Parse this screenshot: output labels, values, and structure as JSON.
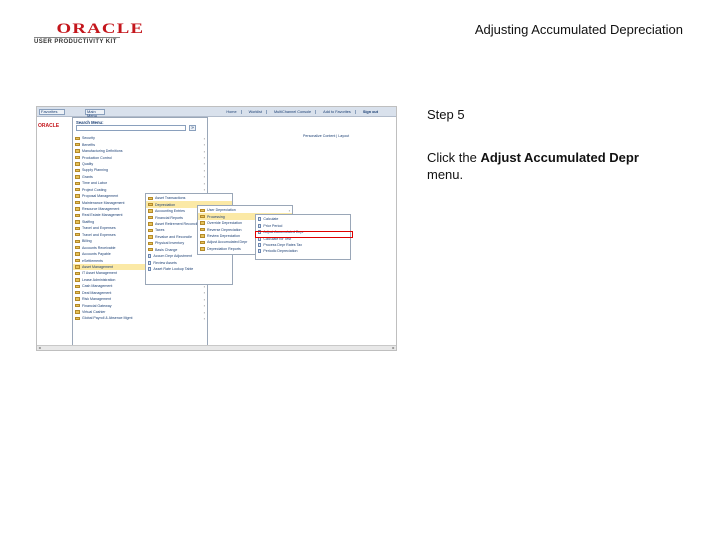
{
  "header": {
    "logo_text": "ORACLE",
    "logo_subtext": "USER PRODUCTIVITY KIT",
    "title": "Adjusting Accumulated Depreciation"
  },
  "instruction": {
    "step_label": "Step 5",
    "text_before": "Click the ",
    "target": "Adjust Accumulated Depr",
    "text_after": " menu."
  },
  "screenshot": {
    "topbar": {
      "favorites": "Favorites",
      "main_menu": "Main Menu",
      "links": [
        "Home",
        "Worklist",
        "MultiChannel Console",
        "Add to Favorites",
        "Sign out"
      ]
    },
    "app_logo": "ORACLE",
    "personalize": "Personalize Content | Layout",
    "search_title": "Search Menu:",
    "search_go": "»",
    "main_menu_items": [
      {
        "label": "Security",
        "icon": "folder-icon",
        "chevron": true
      },
      {
        "label": "Benefits",
        "icon": "folder-icon",
        "chevron": true
      },
      {
        "label": "Manufacturing Definitions",
        "icon": "folder-icon",
        "chevron": true
      },
      {
        "label": "Production Control",
        "icon": "folder-icon",
        "chevron": true
      },
      {
        "label": "Quality",
        "icon": "folder-icon",
        "chevron": true
      },
      {
        "label": "Supply Planning",
        "icon": "folder-icon",
        "chevron": true
      },
      {
        "label": "Grants",
        "icon": "folder-icon",
        "chevron": true
      },
      {
        "label": "Time and Labor",
        "icon": "folder-icon",
        "chevron": true
      },
      {
        "label": "Project Costing",
        "icon": "folder-icon",
        "chevron": true
      },
      {
        "label": "Proposal Management",
        "icon": "folder-icon",
        "chevron": true
      },
      {
        "label": "Maintenance Management",
        "icon": "folder-icon",
        "chevron": true
      },
      {
        "label": "Resource Management",
        "icon": "folder-icon",
        "chevron": true
      },
      {
        "label": "Real Estate Management",
        "icon": "folder-icon",
        "chevron": true
      },
      {
        "label": "Staffing",
        "icon": "folder-icon",
        "chevron": true
      },
      {
        "label": "Travel and Expenses",
        "icon": "folder-icon",
        "chevron": true
      },
      {
        "label": "Travel and Expenses",
        "icon": "folder-icon",
        "chevron": true
      },
      {
        "label": "Billing",
        "icon": "folder-icon",
        "chevron": true
      },
      {
        "label": "Accounts Receivable",
        "icon": "folder-icon",
        "chevron": true
      },
      {
        "label": "Accounts Payable",
        "icon": "folder-icon",
        "chevron": true
      },
      {
        "label": "eSettlements",
        "icon": "folder-icon",
        "chevron": true
      },
      {
        "label": "Asset Management",
        "icon": "folder-icon",
        "chevron": true,
        "state": "hl"
      },
      {
        "label": "IT Asset Management",
        "icon": "folder-icon",
        "chevron": true
      },
      {
        "label": "Lease Administration",
        "icon": "folder-icon",
        "chevron": true
      },
      {
        "label": "Cash Management",
        "icon": "folder-icon",
        "chevron": true
      },
      {
        "label": "Deal Management",
        "icon": "folder-icon",
        "chevron": true
      },
      {
        "label": "Risk Management",
        "icon": "folder-icon",
        "chevron": true
      },
      {
        "label": "Financial Gateway",
        "icon": "folder-icon",
        "chevron": true
      },
      {
        "label": "Virtual Cashier",
        "icon": "folder-icon",
        "chevron": true
      },
      {
        "label": "Global Payroll & Absence Mgmt",
        "icon": "folder-icon",
        "chevron": true
      }
    ],
    "sub1_items": [
      {
        "label": "Asset Transactions",
        "icon": "folder-icon"
      },
      {
        "label": "Depreciation",
        "icon": "folder-icon",
        "state": "hl"
      },
      {
        "label": "Accounting Entries",
        "icon": "folder-icon"
      },
      {
        "label": "Financial Reports",
        "icon": "folder-icon"
      },
      {
        "label": "Asset Retirement Reconcile",
        "icon": "folder-icon"
      },
      {
        "label": "Taxes",
        "icon": "folder-icon"
      },
      {
        "label": "Revalue and Reconcile",
        "icon": "folder-icon"
      },
      {
        "label": "Physical Inventory",
        "icon": "folder-icon"
      },
      {
        "label": "Basis Change",
        "icon": "folder-icon"
      },
      {
        "label": "Accum Depr Adjustment",
        "icon": "doc-icon"
      },
      {
        "label": "Review Assets",
        "icon": "doc-icon"
      },
      {
        "label": "Asset Rate Lookup Table",
        "icon": "doc-icon"
      }
    ],
    "sub2_items": [
      {
        "label": "User Depreciation",
        "icon": "folder-icon",
        "chevron": true
      },
      {
        "label": "Processing",
        "icon": "folder-icon",
        "chevron": true,
        "state": "hl"
      },
      {
        "label": "Override Depreciation",
        "icon": "folder-icon"
      },
      {
        "label": "Reverse Depreciation",
        "icon": "folder-icon"
      },
      {
        "label": "Review Depreciation",
        "icon": "folder-icon"
      },
      {
        "label": "Adjust Accumulated Depr",
        "icon": "folder-icon"
      },
      {
        "label": "Depreciation Reports",
        "icon": "folder-icon"
      }
    ],
    "sub3_items": [
      {
        "label": "Calculate",
        "icon": "doc-icon"
      },
      {
        "label": "Prior Period",
        "icon": "doc-icon"
      },
      {
        "label": "Adjust Accumulated Depr",
        "icon": "doc-icon",
        "state": "target"
      },
      {
        "label": "Calculate for Test",
        "icon": "doc-icon"
      },
      {
        "label": "Process Depr Rates Tax",
        "icon": "doc-icon"
      },
      {
        "label": "Periodic Depreciation",
        "icon": "doc-icon"
      }
    ]
  }
}
